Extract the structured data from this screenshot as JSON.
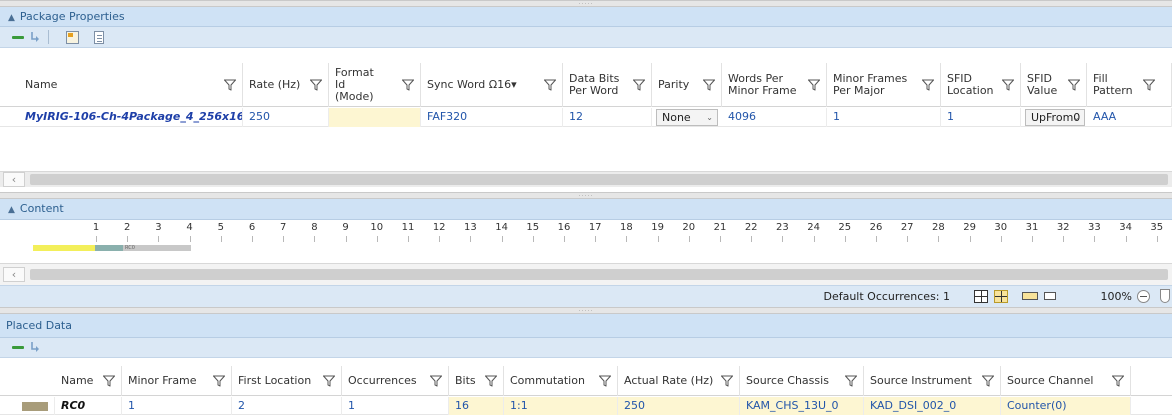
{
  "package_properties": {
    "title": "Package Properties",
    "columns": [
      {
        "label": "Name"
      },
      {
        "label": "Rate (Hz)"
      },
      {
        "label": "Format Id (Mode)"
      },
      {
        "label": "Sync Word Ω16▾"
      },
      {
        "label": "Data Bits Per Word"
      },
      {
        "label": "Parity"
      },
      {
        "label": "Words Per Minor Frame"
      },
      {
        "label": "Minor Frames Per Major"
      },
      {
        "label": "SFID Location"
      },
      {
        "label": "SFID Value"
      },
      {
        "label": "Fill Pattern"
      }
    ],
    "row": {
      "name": "MyIRIG-106-Ch-4Package_4_256x16",
      "rate": "250",
      "format_id": "",
      "sync_word": "FAF320",
      "data_bits": "12",
      "parity": "None",
      "words_per_minor": "4096",
      "minor_frames_per_major": "1",
      "sfid_location": "1",
      "sfid_value": "UpFrom0",
      "fill_pattern": "AAA"
    }
  },
  "content": {
    "title": "Content",
    "ruler_numbers": [
      "1",
      "2",
      "3",
      "4",
      "5",
      "6",
      "7",
      "8",
      "9",
      "10",
      "11",
      "12",
      "13",
      "14",
      "15",
      "16",
      "17",
      "18",
      "19",
      "20",
      "21",
      "22",
      "23",
      "24",
      "25",
      "26",
      "27",
      "28",
      "29",
      "30",
      "31",
      "32",
      "33",
      "34",
      "35"
    ],
    "segment_label": "RC0",
    "default_occurrences_label": "Default Occurrences: 1",
    "zoom_label": "100%"
  },
  "placed_data": {
    "title": "Placed Data",
    "columns": [
      {
        "label": "Name"
      },
      {
        "label": "Minor Frame"
      },
      {
        "label": "First Location"
      },
      {
        "label": "Occurrences"
      },
      {
        "label": "Bits"
      },
      {
        "label": "Commutation"
      },
      {
        "label": "Actual Rate (Hz)"
      },
      {
        "label": "Source Chassis"
      },
      {
        "label": "Source Instrument"
      },
      {
        "label": "Source Channel"
      }
    ],
    "row": {
      "name": "RC0",
      "minor_frame": "1",
      "first_location": "2",
      "occurrences": "1",
      "bits": "16",
      "commutation": "1:1",
      "actual_rate": "250",
      "source_chassis": "KAM_CHS_13U_0",
      "source_instrument": "KAD_DSI_002_0",
      "source_channel": "Counter(0)"
    }
  },
  "colors": {
    "header_blue": "#cfe2f5",
    "link_blue": "#1e3fa8",
    "cell_yellow": "#fdf6d2",
    "segment_yellow": "#f3ef5a",
    "segment_teal": "#8ab0ad",
    "segment_gray": "#c8c8c8"
  }
}
